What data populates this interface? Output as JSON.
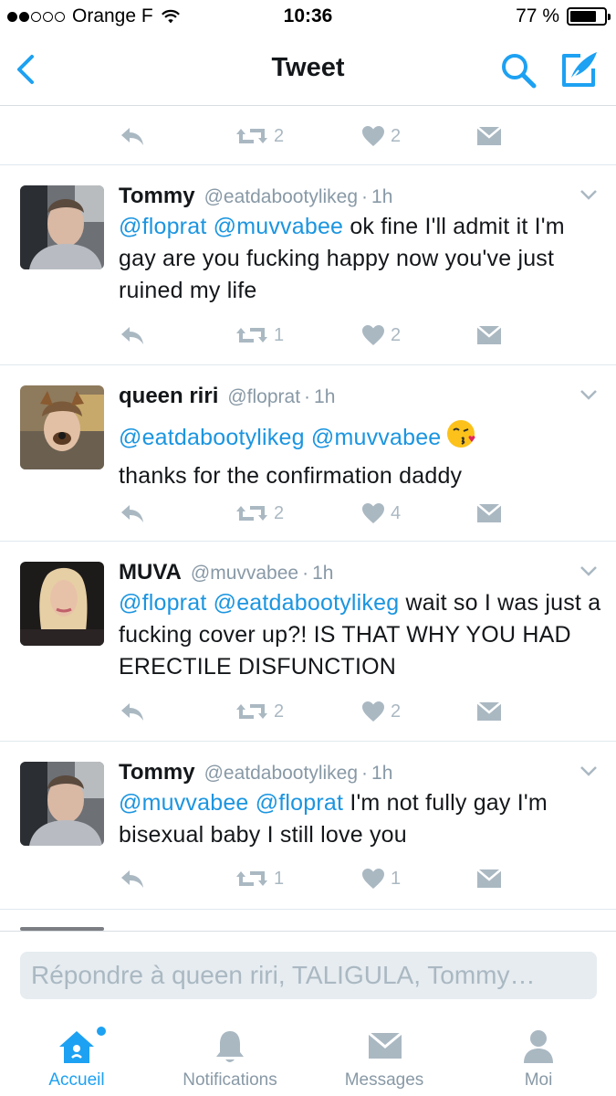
{
  "status_bar": {
    "carrier": "Orange F",
    "time": "10:36",
    "battery": "77 %",
    "battery_level": 0.77,
    "signal_bars_filled": 2,
    "signal_bars_total": 5
  },
  "nav": {
    "title": "Tweet"
  },
  "top_partial": {
    "retweet_count": "2",
    "like_count": "2"
  },
  "tweets": [
    {
      "name": "Tommy",
      "handle": "@eatdabootylikeg",
      "sep": "·",
      "time": "1h",
      "mention1": "@floprat",
      "mention2": "@muvvabee",
      "text": "ok fine I'll admit it I'm gay are you fucking happy now you've just ruined my life",
      "retweet_count": "1",
      "like_count": "2"
    },
    {
      "name": "queen riri",
      "handle": "@floprat",
      "sep": "·",
      "time": "1h",
      "mention1": "@eatdabootylikeg",
      "mention2": "@muvvabee",
      "text": "thanks for the confirmation daddy",
      "emoji": "face-throwing-a-kiss",
      "retweet_count": "2",
      "like_count": "4"
    },
    {
      "name": "MUVA",
      "handle": "@muvvabee",
      "sep": "·",
      "time": "1h",
      "mention1": "@floprat",
      "mention2": "@eatdabootylikeg",
      "text": "wait so I was just a fucking cover up?! IS THAT WHY YOU HAD ERECTILE DISFUNCTION",
      "retweet_count": "2",
      "like_count": "2"
    },
    {
      "name": "Tommy",
      "handle": "@eatdabootylikeg",
      "sep": "·",
      "time": "1h",
      "mention1": "@muvvabee",
      "mention2": "@floprat",
      "text": "I'm not fully gay I'm bisexual baby I still love you",
      "retweet_count": "1",
      "like_count": "1"
    }
  ],
  "reply": {
    "placeholder": "Répondre à queen riri, TALIGULA, Tommy…"
  },
  "tabs": [
    {
      "label": "Accueil",
      "icon": "home-icon",
      "active": true
    },
    {
      "label": "Notifications",
      "icon": "bell-icon",
      "active": false
    },
    {
      "label": "Messages",
      "icon": "envelope-icon",
      "active": false
    },
    {
      "label": "Moi",
      "icon": "person-icon",
      "active": false
    }
  ],
  "colors": {
    "accent": "#1da1f2",
    "mention": "#1b95e0",
    "muted": "#aab8c2",
    "text": "#14171a"
  }
}
